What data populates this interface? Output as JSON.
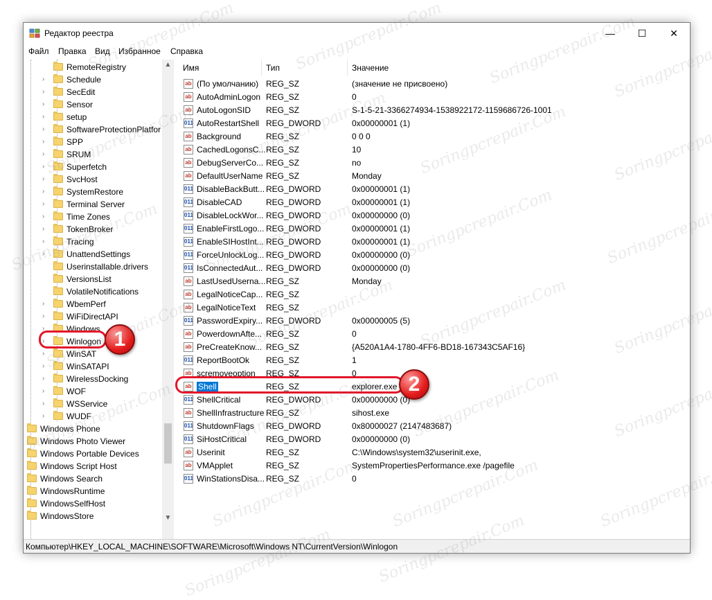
{
  "window": {
    "title": "Редактор реестра",
    "minimize_glyph": "—",
    "maximize_glyph": "☐",
    "close_glyph": "✕"
  },
  "menu": [
    "Файл",
    "Правка",
    "Вид",
    "Избранное",
    "Справка"
  ],
  "tree": {
    "items": [
      {
        "label": "RemoteRegistry",
        "arrow": false
      },
      {
        "label": "Schedule",
        "arrow": true
      },
      {
        "label": "SecEdit",
        "arrow": true
      },
      {
        "label": "Sensor",
        "arrow": true
      },
      {
        "label": "setup",
        "arrow": true
      },
      {
        "label": "SoftwareProtectionPlatfor",
        "arrow": true
      },
      {
        "label": "SPP",
        "arrow": true
      },
      {
        "label": "SRUM",
        "arrow": true
      },
      {
        "label": "Superfetch",
        "arrow": true
      },
      {
        "label": "SvcHost",
        "arrow": true
      },
      {
        "label": "SystemRestore",
        "arrow": true
      },
      {
        "label": "Terminal Server",
        "arrow": true
      },
      {
        "label": "Time Zones",
        "arrow": true
      },
      {
        "label": "TokenBroker",
        "arrow": true
      },
      {
        "label": "Tracing",
        "arrow": true
      },
      {
        "label": "UnattendSettings",
        "arrow": true
      },
      {
        "label": "Userinstallable.drivers",
        "arrow": false
      },
      {
        "label": "VersionsList",
        "arrow": false
      },
      {
        "label": "VolatileNotifications",
        "arrow": false
      },
      {
        "label": "WbemPerf",
        "arrow": true
      },
      {
        "label": "WiFiDirectAPI",
        "arrow": true
      },
      {
        "label": "Windows",
        "arrow": true
      },
      {
        "label": "Winlogon",
        "arrow": true
      },
      {
        "label": "WinSAT",
        "arrow": true
      },
      {
        "label": "WinSATAPI",
        "arrow": true
      },
      {
        "label": "WirelessDocking",
        "arrow": true
      },
      {
        "label": "WOF",
        "arrow": true
      },
      {
        "label": "WSService",
        "arrow": true
      },
      {
        "label": "WUDF",
        "arrow": true
      }
    ],
    "top_items": [
      {
        "label": "Windows Phone"
      },
      {
        "label": "Windows Photo Viewer"
      },
      {
        "label": "Windows Portable Devices"
      },
      {
        "label": "Windows Script Host"
      },
      {
        "label": "Windows Search"
      },
      {
        "label": "WindowsRuntime"
      },
      {
        "label": "WindowsSelfHost"
      },
      {
        "label": "WindowsStore"
      }
    ]
  },
  "list": {
    "headers": {
      "name": "Имя",
      "type": "Тип",
      "value": "Значение"
    },
    "rows": [
      {
        "icon": "ab",
        "name": "(По умолчанию)",
        "type": "REG_SZ",
        "value": "(значение не присвоено)"
      },
      {
        "icon": "ab",
        "name": "AutoAdminLogon",
        "type": "REG_SZ",
        "value": "0"
      },
      {
        "icon": "ab",
        "name": "AutoLogonSID",
        "type": "REG_SZ",
        "value": "S-1-5-21-3366274934-1538922172-1159686726-1001"
      },
      {
        "icon": "011",
        "name": "AutoRestartShell",
        "type": "REG_DWORD",
        "value": "0x00000001 (1)"
      },
      {
        "icon": "ab",
        "name": "Background",
        "type": "REG_SZ",
        "value": "0 0 0"
      },
      {
        "icon": "ab",
        "name": "CachedLogonsC...",
        "type": "REG_SZ",
        "value": "10"
      },
      {
        "icon": "ab",
        "name": "DebugServerCo...",
        "type": "REG_SZ",
        "value": "no"
      },
      {
        "icon": "ab",
        "name": "DefaultUserName",
        "type": "REG_SZ",
        "value": "Monday"
      },
      {
        "icon": "011",
        "name": "DisableBackButt...",
        "type": "REG_DWORD",
        "value": "0x00000001 (1)"
      },
      {
        "icon": "011",
        "name": "DisableCAD",
        "type": "REG_DWORD",
        "value": "0x00000001 (1)"
      },
      {
        "icon": "011",
        "name": "DisableLockWor...",
        "type": "REG_DWORD",
        "value": "0x00000000 (0)"
      },
      {
        "icon": "011",
        "name": "EnableFirstLogo...",
        "type": "REG_DWORD",
        "value": "0x00000001 (1)"
      },
      {
        "icon": "011",
        "name": "EnableSIHostInt...",
        "type": "REG_DWORD",
        "value": "0x00000001 (1)"
      },
      {
        "icon": "011",
        "name": "ForceUnlockLog...",
        "type": "REG_DWORD",
        "value": "0x00000000 (0)"
      },
      {
        "icon": "011",
        "name": "IsConnectedAut...",
        "type": "REG_DWORD",
        "value": "0x00000000 (0)"
      },
      {
        "icon": "ab",
        "name": "LastUsedUserna...",
        "type": "REG_SZ",
        "value": "Monday"
      },
      {
        "icon": "ab",
        "name": "LegalNoticeCap...",
        "type": "REG_SZ",
        "value": ""
      },
      {
        "icon": "ab",
        "name": "LegalNoticeText",
        "type": "REG_SZ",
        "value": ""
      },
      {
        "icon": "011",
        "name": "PasswordExpiry...",
        "type": "REG_DWORD",
        "value": "0x00000005 (5)"
      },
      {
        "icon": "ab",
        "name": "PowerdownAfte...",
        "type": "REG_SZ",
        "value": "0"
      },
      {
        "icon": "ab",
        "name": "PreCreateKnow...",
        "type": "REG_SZ",
        "value": "{A520A1A4-1780-4FF6-BD18-167343C5AF16}"
      },
      {
        "icon": "011",
        "name": "ReportBootOk",
        "type": "REG_SZ",
        "value": "1"
      },
      {
        "icon": "ab",
        "name": "scremoveoption",
        "type": "REG_SZ",
        "value": "0"
      },
      {
        "icon": "ab",
        "name": "Shell",
        "type": "REG_SZ",
        "value": "explorer.exe"
      },
      {
        "icon": "011",
        "name": "ShellCritical",
        "type": "REG_DWORD",
        "value": "0x00000000 (0)"
      },
      {
        "icon": "ab",
        "name": "ShellInfrastructure",
        "type": "REG_SZ",
        "value": "sihost.exe"
      },
      {
        "icon": "011",
        "name": "ShutdownFlags",
        "type": "REG_DWORD",
        "value": "0x80000027 (2147483687)"
      },
      {
        "icon": "011",
        "name": "SiHostCritical",
        "type": "REG_DWORD",
        "value": "0x00000000 (0)"
      },
      {
        "icon": "ab",
        "name": "Userinit",
        "type": "REG_SZ",
        "value": "C:\\Windows\\system32\\userinit.exe,"
      },
      {
        "icon": "ab",
        "name": "VMApplet",
        "type": "REG_SZ",
        "value": "SystemPropertiesPerformance.exe /pagefile"
      },
      {
        "icon": "011",
        "name": "WinStationsDisa...",
        "type": "REG_SZ",
        "value": "0"
      }
    ]
  },
  "status": "Компьютер\\HKEY_LOCAL_MACHINE\\SOFTWARE\\Microsoft\\Windows NT\\CurrentVersion\\Winlogon",
  "callouts": {
    "one": "1",
    "two": "2"
  },
  "watermark": "Soringpcrepair.Com",
  "colors": {
    "selection": "#0078d7",
    "callout": "#e2162a",
    "folder": "#f6d36c"
  }
}
